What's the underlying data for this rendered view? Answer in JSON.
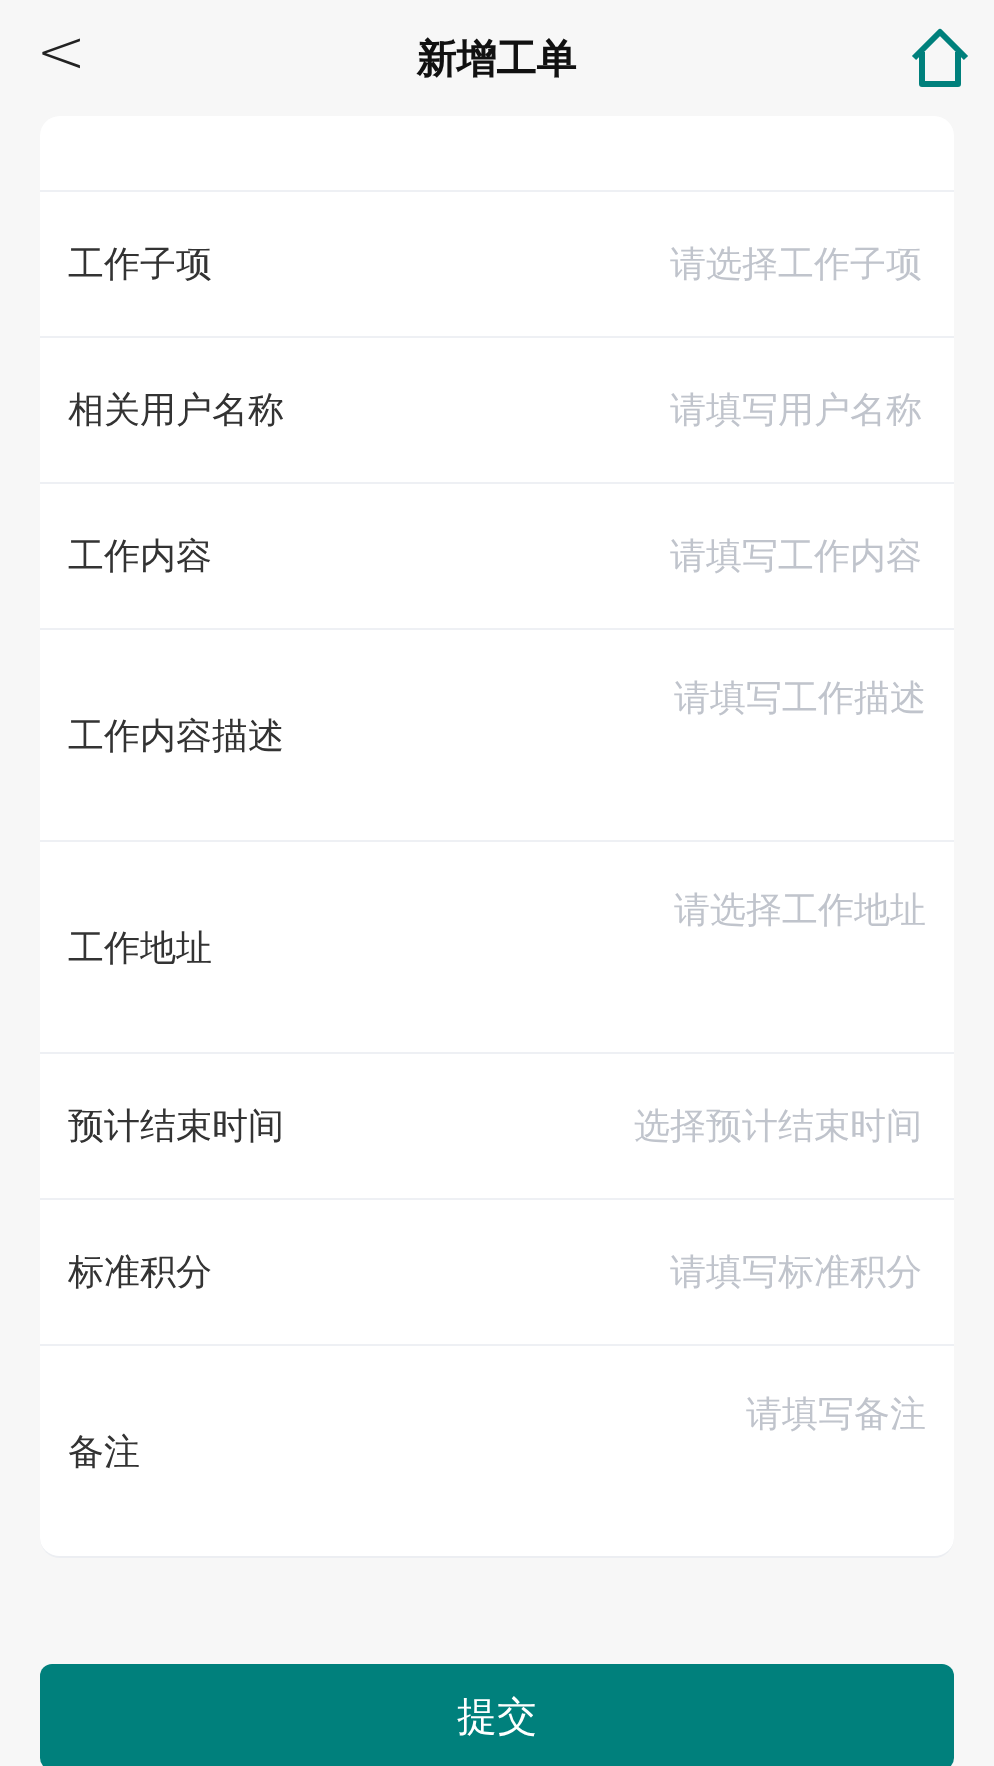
{
  "header": {
    "back": "<",
    "title": "新增工单"
  },
  "fields": [
    {
      "kind": "single",
      "label": "工作子项",
      "placeholder": "请选择工作子项"
    },
    {
      "kind": "single",
      "label": "相关用户名称",
      "placeholder": "请填写用户名称"
    },
    {
      "kind": "single",
      "label": "工作内容",
      "placeholder": "请填写工作内容"
    },
    {
      "kind": "multi",
      "label": "工作内容描述",
      "placeholder": "请填写工作描述"
    },
    {
      "kind": "multi",
      "label": "工作地址",
      "placeholder": "请选择工作地址"
    },
    {
      "kind": "single",
      "label": "预计结束时间",
      "placeholder": "选择预计结束时间"
    },
    {
      "kind": "single",
      "label": "标准积分",
      "placeholder": "请填写标准积分"
    },
    {
      "kind": "multi",
      "label": "备注",
      "placeholder": "请填写备注"
    }
  ],
  "submit": "提交"
}
